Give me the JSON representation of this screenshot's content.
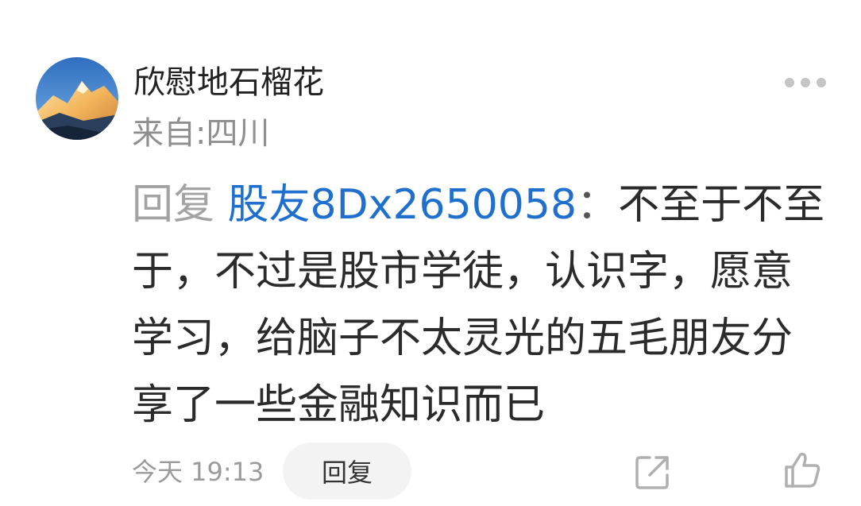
{
  "comment": {
    "user": {
      "name": "欣慰地石榴花",
      "location": "来自:四川"
    },
    "reply_prefix": "回复",
    "mention": "股友8Dx2650058",
    "separator": "：",
    "text": "不至于不至于，不过是股市学徒，认识字，愿意学习，给脑子不太灵光的五毛朋友分享了一些金融知识而已",
    "time": "今天 19:13",
    "reply_label": "回复"
  },
  "icons": {
    "more": "more-dots-icon",
    "share": "share-icon",
    "like": "thumbs-up-icon"
  },
  "colors": {
    "mention": "#1f6fce",
    "secondary_text": "#8f8f8f",
    "icon": "#b0b0b0"
  }
}
